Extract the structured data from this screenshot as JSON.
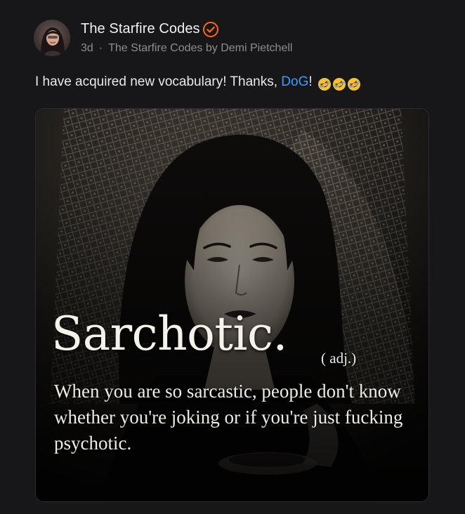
{
  "post": {
    "author": {
      "name": "The Starfire Codes",
      "verified": true,
      "avatar_icon": "avatar"
    },
    "time_ago": "3d",
    "separator": "·",
    "publication": "The Starfire Codes by Demi Pietchell",
    "text_before": "I have acquired new vocabulary! Thanks, ",
    "mention": "DoG",
    "text_after": "!",
    "emojis": [
      "rolling-on-floor-laughing-icon",
      "rolling-on-floor-laughing-icon",
      "rolling-on-floor-laughing-icon"
    ],
    "image": {
      "word": "Sarchotic.",
      "part_of_speech": "( adj.)",
      "definition": "When you are so sarcastic, people don't know whether you're joking or if you're just fucking psychotic."
    }
  },
  "colors": {
    "background": "#17171a",
    "mention": "#3e9bff",
    "verified_badge": "#ff6719",
    "meta_text": "#8c8c93"
  }
}
